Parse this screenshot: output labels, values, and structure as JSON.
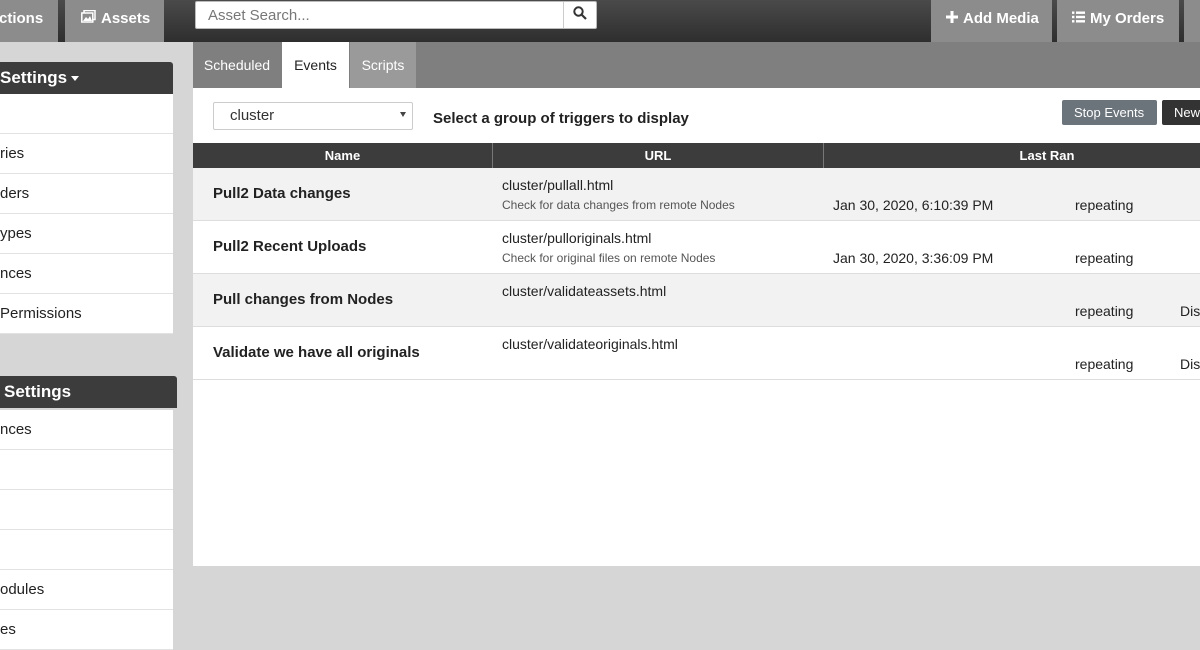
{
  "topnav": {
    "collections_label": "ctions",
    "assets_label": "Assets",
    "search_placeholder": "Asset Search...",
    "add_media_label": "Add Media",
    "my_orders_label": "My Orders"
  },
  "sidebar": {
    "panel1": {
      "title": "Settings",
      "items": [
        "",
        "ries",
        "ders",
        "ypes",
        "nces",
        " Permissions"
      ]
    },
    "panel2": {
      "title": "Settings",
      "items": [
        "nces",
        "",
        "",
        "",
        "odules",
        "es"
      ]
    }
  },
  "tabs": [
    "Scheduled",
    "Events",
    "Scripts"
  ],
  "active_tab": "Events",
  "filter": {
    "selected": "cluster",
    "hint": "Select a group of triggers to display"
  },
  "buttons": {
    "stop": "Stop Events",
    "new": "New"
  },
  "table": {
    "headers": [
      "Name",
      "URL",
      "Last Ran"
    ],
    "rows": [
      {
        "name": "Pull2 Data changes",
        "url": "cluster/pullall.html",
        "desc": "Check for data changes from remote Nodes",
        "last_ran": "Jan 30, 2020, 6:10:39 PM",
        "schedule": "repeating",
        "extra": ""
      },
      {
        "name": "Pull2 Recent Uploads",
        "url": "cluster/pulloriginals.html",
        "desc": "Check for original files on remote Nodes",
        "last_ran": "Jan 30, 2020, 3:36:09 PM",
        "schedule": "repeating",
        "extra": ""
      },
      {
        "name": "Pull changes from Nodes",
        "url": "cluster/validateassets.html",
        "desc": "",
        "last_ran": "",
        "schedule": "repeating",
        "extra": "Dis"
      },
      {
        "name": "Validate we have all originals",
        "url": "cluster/validateoriginals.html",
        "desc": "",
        "last_ran": "",
        "schedule": "repeating",
        "extra": "Dis"
      }
    ]
  },
  "colors": {
    "topbar": "#333333",
    "nav_button": "#8c8c8c",
    "panel_header": "#3c3c3c",
    "tab_strip": "#7f7f7f",
    "stop_button": "#6b737b",
    "new_button": "#333333"
  }
}
